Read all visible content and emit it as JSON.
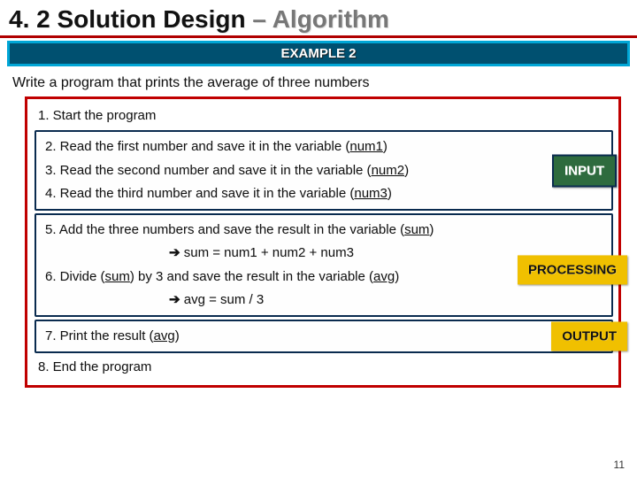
{
  "title": {
    "section": "4. 2 Solution Design",
    "sep": " – ",
    "topic": "Algorithm"
  },
  "example_label": "EXAMPLE 2",
  "task": "Write a program that prints the average of three numbers",
  "step1": "1. Start the program",
  "input": {
    "s2a": "2. Read the first number and save it in  the variable (",
    "s2v": "num1",
    "s2b": ")",
    "s3a": "3. Read the second number and save it in the variable (",
    "s3v": "num2",
    "s3b": ")",
    "s4a": "4. Read the third number and save it in the variable (",
    "s4v": "num3",
    "s4b": ")",
    "label": "INPUT"
  },
  "proc": {
    "s5a": "5. Add the three numbers and save the result in the variable  (",
    "s5v": "sum",
    "s5b": ")",
    "s5f_arrow": "➔",
    "s5f": " sum = num1 + num2 + num3",
    "s6a": "6. Divide (",
    "s6v1": "sum",
    "s6b": ") by 3 and save the result in the variable (",
    "s6v2": "avg",
    "s6c": ")",
    "s6f_arrow": "➔",
    "s6f": " avg = sum / 3",
    "label": "PROCESSING"
  },
  "out": {
    "s7a": "7. Print the result (",
    "s7v": "avg",
    "s7b": ")",
    "label": "OUTPUT"
  },
  "step8": "8. End the program",
  "pagenum": "11"
}
